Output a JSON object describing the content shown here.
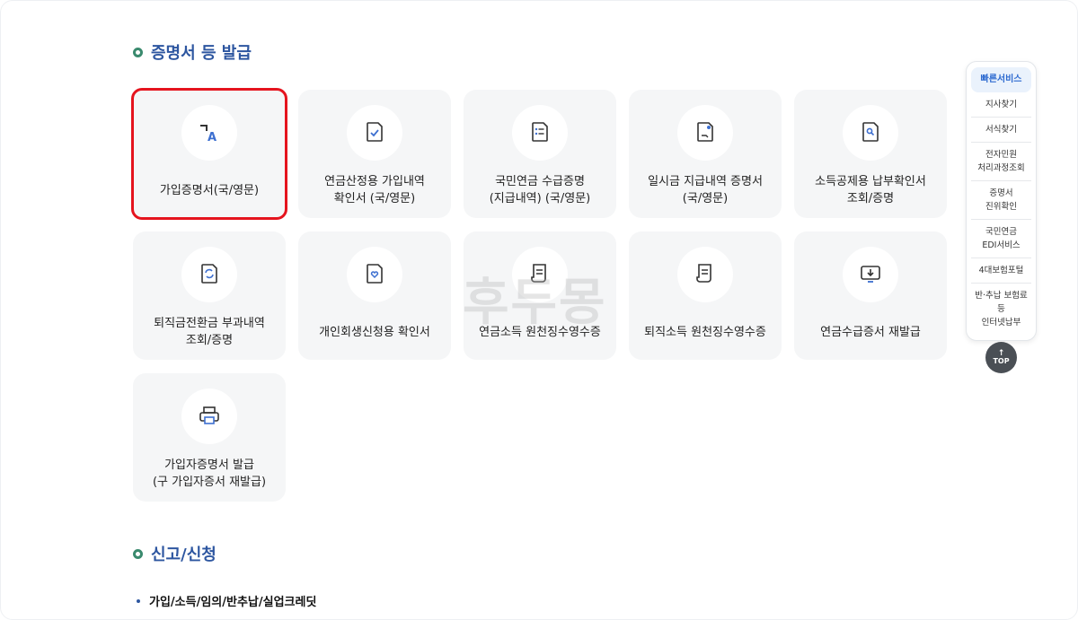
{
  "sections": {
    "certificates": "증명서 등 발급",
    "report": "신고/신청"
  },
  "cards": [
    {
      "label": "가입증명서(국/영문)",
      "icon": "translate-icon"
    },
    {
      "label": "연금산정용 가입내역\n확인서 (국/영문)",
      "icon": "document-check-icon"
    },
    {
      "label": "국민연금 수급증명\n(지급내역) (국/영문)",
      "icon": "document-list-icon"
    },
    {
      "label": "일시금 지급내역 증명서\n(국/영문)",
      "icon": "document-stamp-icon"
    },
    {
      "label": "소득공제용 납부확인서\n조회/증명",
      "icon": "document-search-icon"
    },
    {
      "label": "퇴직금전환금 부과내역\n조회/증명",
      "icon": "document-refresh-icon"
    },
    {
      "label": "개인회생신청용 확인서",
      "icon": "document-heart-icon"
    },
    {
      "label": "연금소득 원천징수영수증",
      "icon": "receipt-icon"
    },
    {
      "label": "퇴직소득 원천징수영수증",
      "icon": "receipt-icon"
    },
    {
      "label": "연금수급증서 재발급",
      "icon": "monitor-download-icon"
    },
    {
      "label": "가입자증명서 발급\n(구 가입자증서 재발급)",
      "icon": "printer-icon"
    }
  ],
  "watermark": "후두몽",
  "report_item": "가입/소득/임의/반추납/실업크레딧",
  "quick_service": {
    "title": "빠른서비스",
    "items": [
      "지사찾기",
      "서식찾기",
      "전자민원\n처리과정조회",
      "증명서\n진위확인",
      "국민연금\nEDI서비스",
      "4대보험포털",
      "반·추납 보험료등\n인터넷납부"
    ],
    "top": "TOP"
  },
  "colors": {
    "accent": "#2d56a0",
    "selected_border": "#e5141e",
    "icon_blue": "#3d6fd0"
  }
}
